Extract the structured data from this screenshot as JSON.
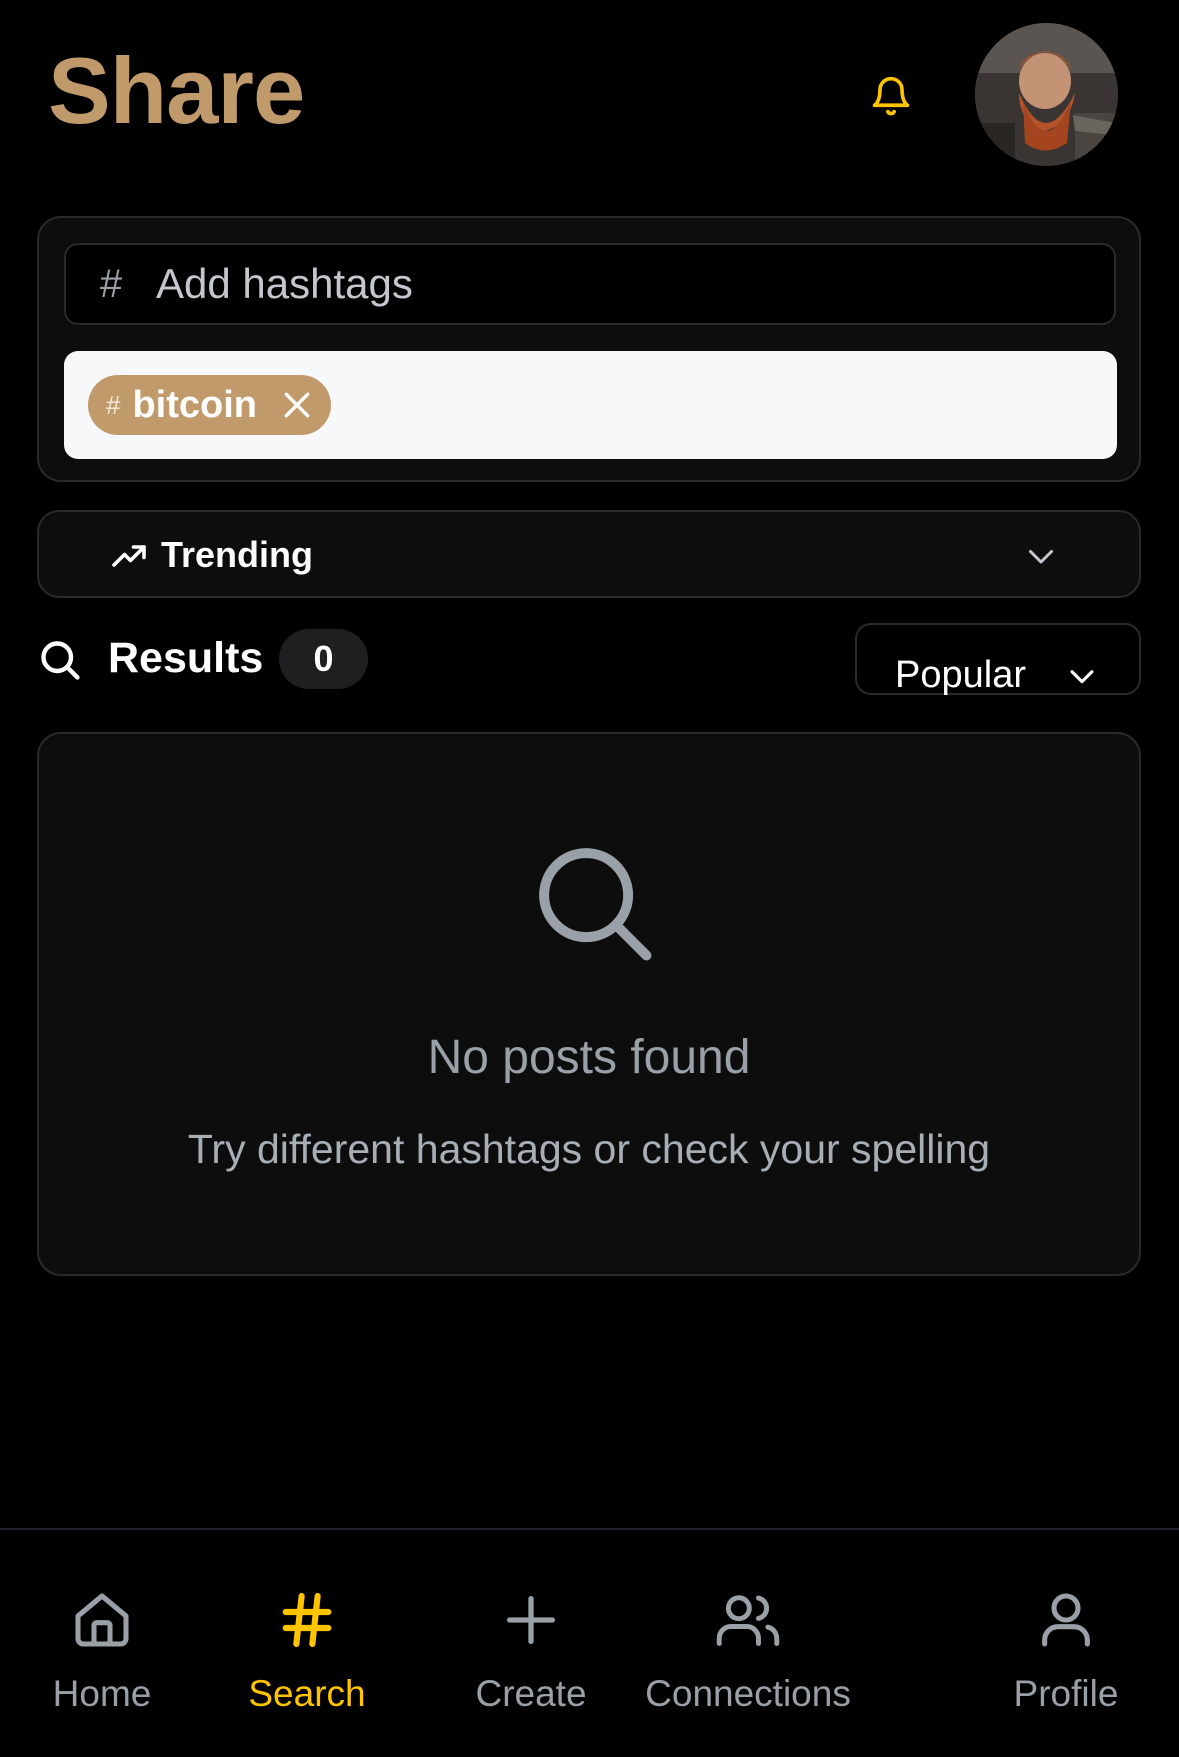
{
  "header": {
    "title": "Share",
    "bell_icon": "bell-icon",
    "avatar_icon": "user-avatar"
  },
  "hashtags": {
    "input_prefix": "#",
    "input_placeholder": "Add hashtags",
    "input_value": "",
    "chips": [
      {
        "prefix": "#",
        "label": "bitcoin",
        "remove_icon": "close-icon"
      }
    ]
  },
  "trending": {
    "label": "Trending",
    "icon": "trending-up-icon",
    "chevron": "chevron-down-icon"
  },
  "results": {
    "label": "Results",
    "count": "0",
    "sort": {
      "selected": "Popular"
    }
  },
  "empty_state": {
    "icon": "search-icon",
    "title": "No posts found",
    "subtitle": "Try different hashtags or check your spelling"
  },
  "bottom_nav": {
    "items": [
      {
        "label": "Home",
        "icon": "home-icon",
        "active": false
      },
      {
        "label": "Search",
        "icon": "hash-icon",
        "active": true
      },
      {
        "label": "Create",
        "icon": "plus-icon",
        "active": false
      },
      {
        "label": "Connections",
        "icon": "users-icon",
        "active": false
      },
      {
        "label": "Profile",
        "icon": "user-icon",
        "active": false
      }
    ]
  },
  "colors": {
    "brand": "#c19a6b",
    "accent_active": "#ffc400",
    "background": "#000000",
    "card": "#0d0d0e",
    "muted_text": "#9aa0a8"
  }
}
